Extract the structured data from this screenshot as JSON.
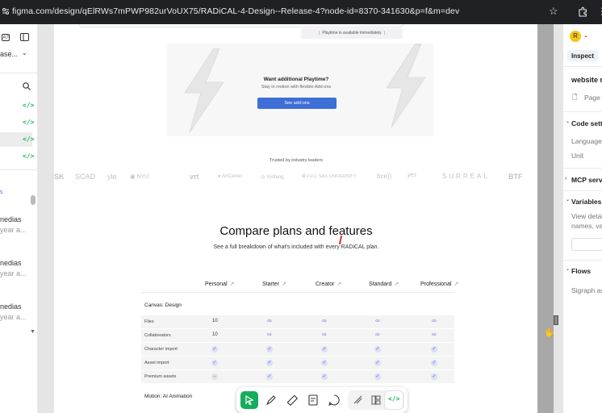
{
  "browser": {
    "url": "figma.com/design/qElRWs7mPWP982urVoUX75/RADiCAL-4-Design--Release-4?node-id=8370-341630&p=f&m=dev"
  },
  "left_panel": {
    "title": "ase...",
    "items": [
      {
        "label": "nedias",
        "sub": "year a..."
      },
      {
        "label": "nedias",
        "sub": "year a..."
      },
      {
        "label": "nedias",
        "sub": "year a..."
      }
    ]
  },
  "page": {
    "playtime_note": "Playtime is available immediately",
    "addon_title": "Want additional Playtime?",
    "addon_sub": "Stay in motion with flexible Add-ons",
    "addon_button": "See add-ons",
    "trusted": "Trusted by industry leaders",
    "logos": [
      "SK",
      "SCAD",
      "yle",
      "NYU",
      "vrt",
      "ArtCenter",
      "Yonfeng",
      "FULL SAIL UNIVERSITY",
      "bce))",
      "yes",
      "SURREAL",
      "BTF"
    ],
    "compare_title": "Compare plans and features",
    "compare_sub": "See a full breakdown of what's included with every RADiCAL plan.",
    "plans": [
      "Personal",
      "Starter",
      "Creator",
      "Standard",
      "Professional"
    ],
    "section1": "Canvas: Design",
    "rows": [
      {
        "label": "Files",
        "cells": [
          "10",
          "∞",
          "∞",
          "∞",
          "∞"
        ]
      },
      {
        "label": "Collaborators",
        "cells": [
          "10",
          "∞",
          "∞",
          "∞",
          "∞"
        ]
      },
      {
        "label": "Character import",
        "cells": [
          "check",
          "check",
          "check",
          "check",
          "check"
        ]
      },
      {
        "label": "Asset import",
        "cells": [
          "check",
          "check",
          "check",
          "check",
          "check"
        ]
      },
      {
        "label": "Premium assets",
        "cells": [
          "dash",
          "check",
          "check",
          "check",
          "check"
        ]
      }
    ],
    "section2": "Motion: AI Animation"
  },
  "right_panel": {
    "avatar": "R",
    "tab": "Inspect",
    "name": "website n",
    "page": "Page",
    "code_settings": "Code setti",
    "language": "Language",
    "unit": "Unit",
    "mcp": "MCP serve",
    "variables": "Variables",
    "var_desc1": "View detail",
    "var_desc2": "names, val",
    "flows": "Flows",
    "flow_item": "Sigraph asi"
  },
  "colors": {
    "accent": "#3d6fd6",
    "green": "#14ae5c",
    "infinity": "#7b7fd6"
  }
}
